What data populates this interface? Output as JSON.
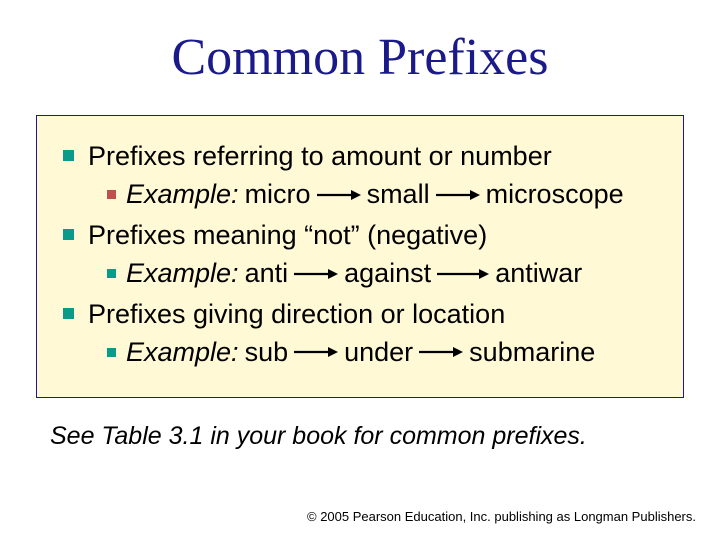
{
  "title": "Common Prefixes",
  "items": [
    {
      "heading": "Prefixes referring to amount or number",
      "example_label": "Example:",
      "w1": "micro",
      "w2": "small",
      "w3": "microscope",
      "sub_bullet": "red"
    },
    {
      "heading": "Prefixes meaning “not” (negative)",
      "example_label": "Example:",
      "w1": "anti",
      "w2": "against",
      "w3": "antiwar",
      "sub_bullet": "teal"
    },
    {
      "heading": "Prefixes giving direction or location",
      "example_label": "Example:",
      "w1": "sub",
      "w2": "under",
      "w3": "submarine",
      "sub_bullet": "teal"
    }
  ],
  "footnote": "See Table 3.1 in your book for common prefixes.",
  "copyright": "© 2005 Pearson Education, Inc. publishing as Longman Publishers."
}
